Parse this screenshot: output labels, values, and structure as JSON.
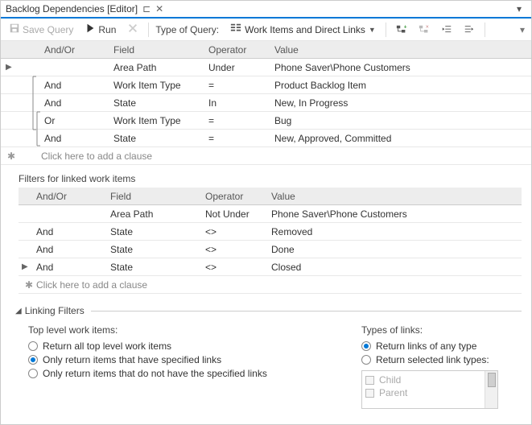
{
  "tab": {
    "title": "Backlog Dependencies [Editor]"
  },
  "toolbar": {
    "save": "Save Query",
    "run": "Run",
    "type_label": "Type of Query:",
    "query_type": "Work Items and Direct Links"
  },
  "headers": {
    "andor": "And/Or",
    "field": "Field",
    "operator": "Operator",
    "value": "Value"
  },
  "top_clauses": [
    {
      "marker": "▶",
      "andor": "",
      "field": "Area Path",
      "op": "Under",
      "value": "Phone Saver\\Phone Customers"
    },
    {
      "marker": "",
      "andor": "And",
      "field": "Work Item Type",
      "op": "=",
      "value": "Product Backlog Item"
    },
    {
      "marker": "",
      "andor": "And",
      "field": "State",
      "op": "In",
      "value": "New, In Progress"
    },
    {
      "marker": "",
      "andor": "Or",
      "field": "Work Item Type",
      "op": "=",
      "value": "Bug"
    },
    {
      "marker": "",
      "andor": "And",
      "field": "State",
      "op": "=",
      "value": "New, Approved, Committed"
    }
  ],
  "new_clause": "Click here to add a clause",
  "linked_label": "Filters for linked work items",
  "linked_clauses": [
    {
      "marker": "",
      "andor": "",
      "field": "Area Path",
      "op": "Not Under",
      "value": "Phone Saver\\Phone Customers"
    },
    {
      "marker": "",
      "andor": "And",
      "field": "State",
      "op": "<>",
      "value": "Removed"
    },
    {
      "marker": "",
      "andor": "And",
      "field": "State",
      "op": "<>",
      "value": "Done"
    },
    {
      "marker": "▶",
      "andor": "And",
      "field": "State",
      "op": "<>",
      "value": "Closed"
    }
  ],
  "linking": {
    "title": "Linking Filters",
    "top_label": "Top level work items:",
    "opt1": "Return all top level work items",
    "opt2": "Only return items that have specified links",
    "opt3": "Only return items that do not have the specified links",
    "types_label": "Types of links:",
    "topt1": "Return links of any type",
    "topt2": "Return selected link types:",
    "lt1": "Child",
    "lt2": "Parent"
  }
}
